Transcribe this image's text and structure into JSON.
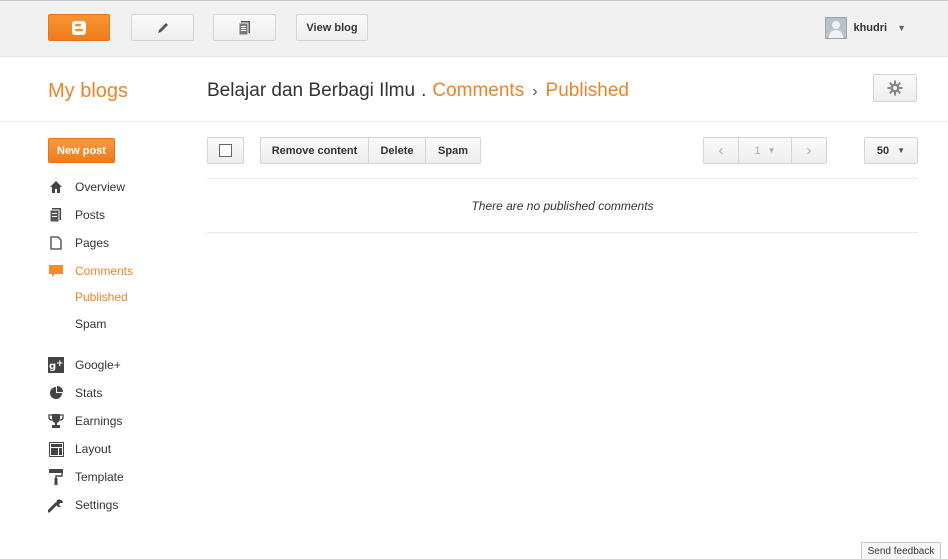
{
  "topbar": {
    "view_blog_label": "View blog",
    "account_name": "khudri",
    "blogger_color": "#f38b2a"
  },
  "header": {
    "my_blogs": "My blogs",
    "blog_name": "Belajar dan Berbagi Ilmu",
    "section": "Comments",
    "subsection": "Published",
    "separator": "›"
  },
  "sidebar": {
    "new_post_label": "New post",
    "items": [
      {
        "label": "Overview",
        "icon": "home-icon"
      },
      {
        "label": "Posts",
        "icon": "posts-icon"
      },
      {
        "label": "Pages",
        "icon": "pages-icon"
      },
      {
        "label": "Comments",
        "icon": "comment-icon",
        "active": true
      },
      {
        "label": "Google+",
        "icon": "google-plus-icon"
      },
      {
        "label": "Stats",
        "icon": "stats-icon"
      },
      {
        "label": "Earnings",
        "icon": "trophy-icon"
      },
      {
        "label": "Layout",
        "icon": "layout-icon"
      },
      {
        "label": "Template",
        "icon": "paint-roller-icon"
      },
      {
        "label": "Settings",
        "icon": "wrench-icon"
      }
    ],
    "comments_sub": [
      {
        "label": "Published",
        "active": true
      },
      {
        "label": "Spam"
      }
    ]
  },
  "toolbar": {
    "remove_content": "Remove content",
    "delete": "Delete",
    "spam": "Spam",
    "page_number": "1",
    "per_page": "50"
  },
  "main": {
    "empty_message": "There are no published comments"
  },
  "footer": {
    "send_feedback": "Send feedback"
  },
  "colors": {
    "accent": "#e8842b",
    "text": "#333333"
  }
}
